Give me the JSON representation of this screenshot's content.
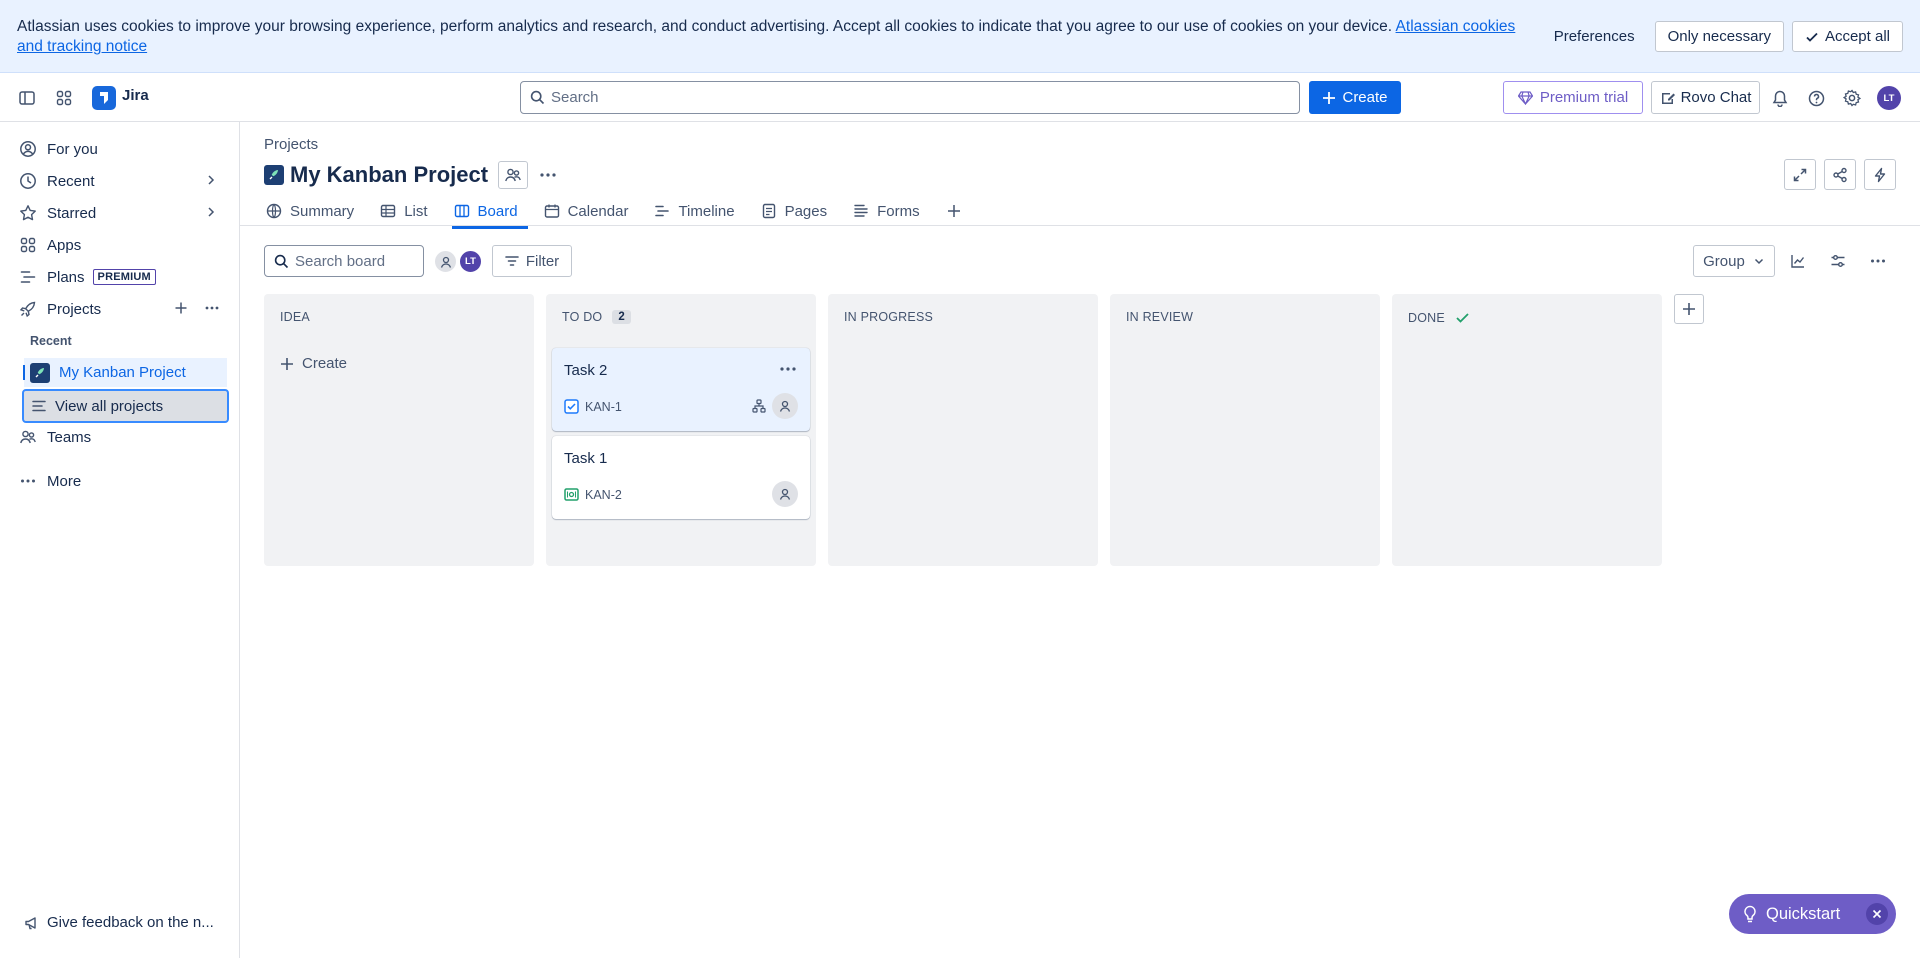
{
  "cookie": {
    "text": "Atlassian uses cookies to improve your browsing experience, perform analytics and research, and conduct advertising. Accept all cookies to indicate that you agree to our use of cookies on your device.",
    "link": "Atlassian cookies and tracking notice",
    "preferences": "Preferences",
    "only_necessary": "Only necessary",
    "accept_all": "Accept all"
  },
  "topbar": {
    "app_name": "Jira",
    "search_placeholder": "Search",
    "create": "Create",
    "premium_trial": "Premium trial",
    "rovo_chat": "Rovo Chat",
    "user_initials": "LT"
  },
  "sidebar": {
    "for_you": "For you",
    "recent": "Recent",
    "starred": "Starred",
    "apps": "Apps",
    "plans": "Plans",
    "plans_badge": "PREMIUM",
    "projects": "Projects",
    "recent_label": "Recent",
    "project_name": "My Kanban Project",
    "view_all": "View all projects",
    "teams": "Teams",
    "more": "More",
    "feedback": "Give feedback on the n..."
  },
  "main": {
    "breadcrumb": "Projects",
    "title": "My Kanban Project",
    "tabs": [
      {
        "label": "Summary"
      },
      {
        "label": "List"
      },
      {
        "label": "Board"
      },
      {
        "label": "Calendar"
      },
      {
        "label": "Timeline"
      },
      {
        "label": "Pages"
      },
      {
        "label": "Forms"
      }
    ],
    "search_board_placeholder": "Search board",
    "filter": "Filter",
    "group": "Group"
  },
  "board": {
    "columns": [
      {
        "title": "IDEA",
        "create": "Create"
      },
      {
        "title": "TO DO",
        "count": "2"
      },
      {
        "title": "IN PROGRESS"
      },
      {
        "title": "IN REVIEW"
      },
      {
        "title": "DONE"
      }
    ],
    "cards": [
      {
        "title": "Task 2",
        "key": "KAN-1"
      },
      {
        "title": "Task 1",
        "key": "KAN-2"
      }
    ]
  },
  "quickstart": {
    "label": "Quickstart"
  },
  "colors": {
    "accent": "#0c66e4",
    "banner": "#e9f2ff",
    "quickstart": "#6e5dc6"
  }
}
